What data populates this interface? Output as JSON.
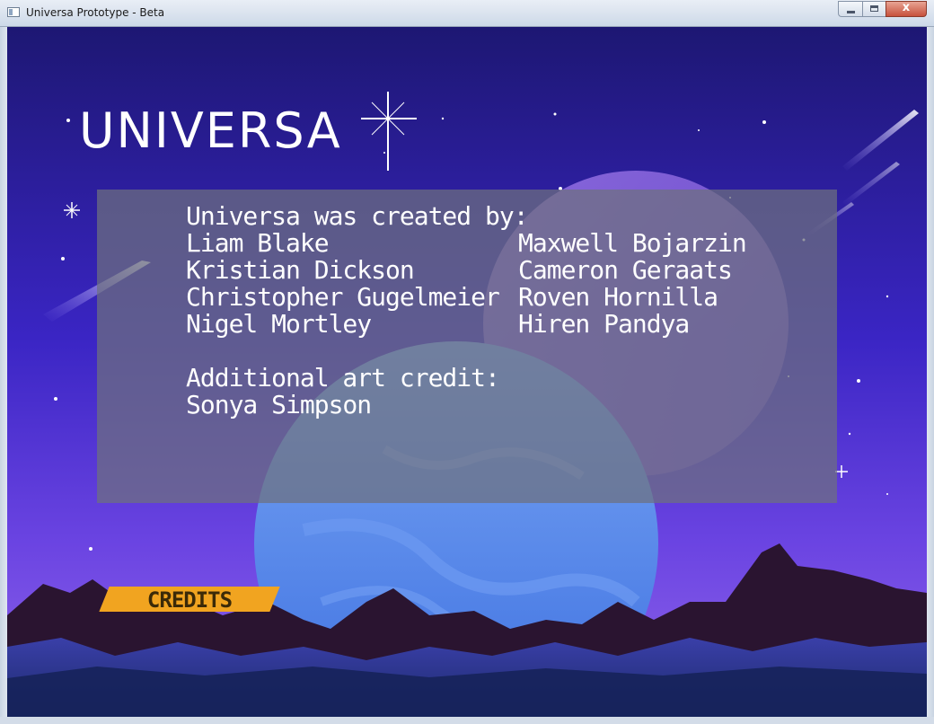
{
  "window": {
    "title": "Universa Prototype - Beta",
    "close_label": "x"
  },
  "game": {
    "logo": "UNIVERSA",
    "credits_button": "CREDITS",
    "credits": {
      "heading": "Universa was created by:",
      "creators": [
        [
          "Liam Blake",
          "Maxwell Bojarzin"
        ],
        [
          "Kristian Dickson",
          "Cameron Geraats"
        ],
        [
          "Christopher Gugelmeier",
          "Roven Hornilla"
        ],
        [
          "Nigel Mortley",
          "Hiren Pandya"
        ]
      ],
      "art_heading": "Additional art credit:",
      "art_credit": "Sonya Simpson"
    }
  },
  "colors": {
    "sky_top": "#1d1773",
    "sky_mid": "#4a2fd6",
    "sky_bottom": "#8a5fe8",
    "planet": "#5a8dee",
    "mountains_dark": "#2a1430",
    "button": "#f1a420",
    "panel": "#6e707e"
  }
}
